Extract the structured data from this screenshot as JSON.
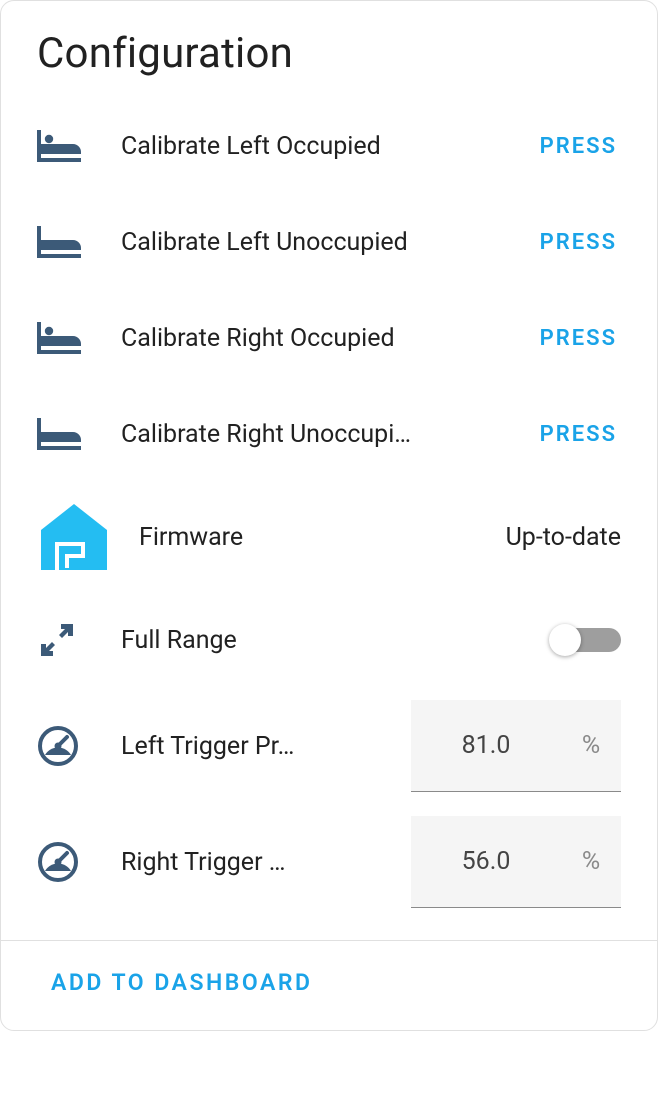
{
  "title": "Configuration",
  "rows": {
    "calibrate_left_occupied": {
      "label": "Calibrate Left Occupied",
      "action": "PRESS"
    },
    "calibrate_left_unoccupied": {
      "label": "Calibrate Left Unoccupied",
      "action": "PRESS"
    },
    "calibrate_right_occupied": {
      "label": "Calibrate Right Occupied",
      "action": "PRESS"
    },
    "calibrate_right_unoccupied": {
      "label": "Calibrate Right Unoccupi…",
      "action": "PRESS"
    },
    "firmware": {
      "label": "Firmware",
      "status": "Up-to-date"
    },
    "full_range": {
      "label": "Full Range",
      "value": false
    },
    "left_trigger": {
      "label": "Left Trigger Pr…",
      "value": "81.0",
      "unit": "%"
    },
    "right_trigger": {
      "label": "Right Trigger …",
      "value": "56.0",
      "unit": "%"
    }
  },
  "footer": {
    "add_to_dashboard": "ADD TO DASHBOARD"
  },
  "colors": {
    "accent": "#1aa3e8",
    "icon": "#3c5a78"
  }
}
